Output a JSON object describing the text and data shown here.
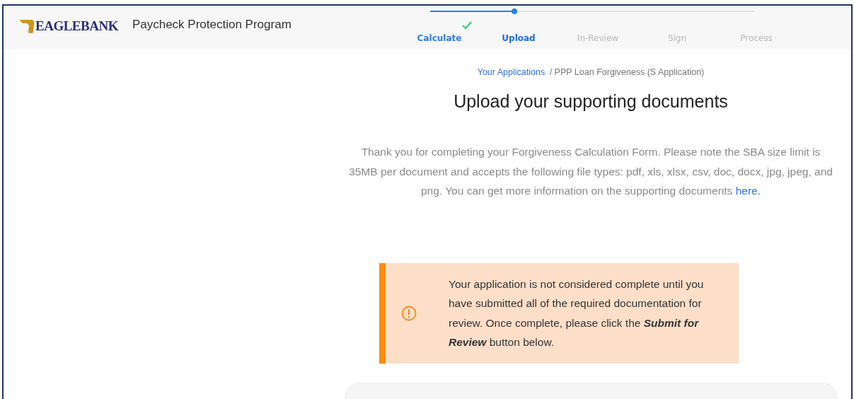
{
  "header": {
    "logo_text": "EAGLEBANK",
    "title": "Paycheck Protection Program"
  },
  "stepper": {
    "level": 0.26,
    "steps": [
      {
        "label": "Calculate",
        "done": true,
        "selected": false
      },
      {
        "label": "Upload",
        "done": false,
        "selected": true
      },
      {
        "label": "In-Review",
        "done": false,
        "selected": false
      },
      {
        "label": "Sign",
        "done": false,
        "selected": false
      },
      {
        "label": "Process",
        "done": false,
        "selected": false
      }
    ]
  },
  "breadcrumb": {
    "link": "Your Applications",
    "current": "/ PPP Loan Forgiveness (S Application)"
  },
  "heading": "Upload your supporting documents",
  "intro": {
    "text": "Thank you for completing your Forgiveness Calculation Form. Please note the SBA size limit is 35MB per document and accepts the following file types: pdf, xls, xlsx, csv, doc, docx, jpg, jpeg, and png. You can get more information on the supporting documents",
    "link": "here."
  },
  "alert": {
    "kind": "warning",
    "text": "Your application is not considered complete until you have submitted all of the required documentation for review. Once complete, please click the **Submit for Review** button below."
  }
}
